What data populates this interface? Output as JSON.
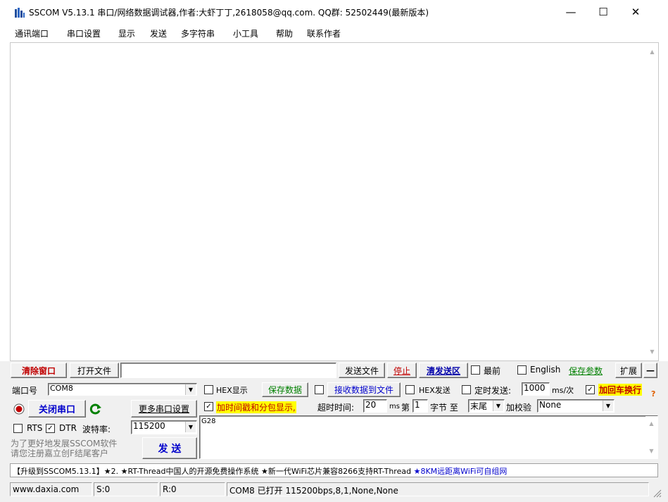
{
  "title": "SSCOM V5.13.1 串口/网络数据调试器,作者:大虾丁丁,2618058@qq.com. QQ群: 52502449(最新版本)",
  "window_controls": {
    "minimize": "—",
    "maximize": "☐",
    "close": "✕"
  },
  "menu": [
    "通讯端口",
    "串口设置",
    "显示",
    "发送",
    "多字符串",
    "小工具",
    "帮助",
    "联系作者"
  ],
  "toolbar": {
    "clear_window": "清除窗口",
    "open_file": "打开文件",
    "file_path": "",
    "send_file": "发送文件",
    "stop": "停止",
    "clear_send": "清发送区",
    "topmost": "最前",
    "english": "English",
    "save_params": "保存参数",
    "expand": "扩展",
    "collapse": "—"
  },
  "port": {
    "label": "端口号",
    "value": "COM8",
    "close_port": "关闭串口",
    "more_settings": "更多串口设置",
    "rts": "RTS",
    "rts_checked": false,
    "dtr": "DTR",
    "dtr_checked": true,
    "baud_label": "波特率:",
    "baud_value": "115200",
    "promo1": "为了更好地发展SSCOM软件",
    "promo2": "请您注册嘉立创F结尾客户",
    "send": "发 送"
  },
  "options": {
    "hex_display": "HEX显示",
    "hex_display_checked": false,
    "save_data": "保存数据",
    "recv_to_file": "接收数据到文件",
    "recv_to_file_checked": false,
    "hex_send": "HEX发送",
    "hex_send_checked": false,
    "timed_send": "定时发送:",
    "timed_send_checked": false,
    "interval": "1000",
    "interval_unit": "ms/次",
    "add_newline": "加回车换行",
    "add_newline_checked": true,
    "timestamp": "加时间戳和分包显示,",
    "timestamp_checked": true,
    "timeout_label": "超时时间:",
    "timeout_value": "20",
    "timeout_unit": "ms",
    "nth_label": "第",
    "nth_value": "1",
    "byte_to": "字节 至",
    "end_select": "末尾",
    "checksum_label": "加校验",
    "checksum_value": "None",
    "question": "?"
  },
  "send_text": "G28",
  "ticker": {
    "part1": "【升级到SSCOM5.13.1】★2. ★RT-Thread中国人的开源免费操作系统 ★新一代WiFi芯片兼容8266支持RT-Thread",
    "part2": "★8KM远距离WiFi可自组网"
  },
  "status": {
    "site": "www.daxia.com",
    "sent": "S:0",
    "recv": "R:0",
    "port_status": "COM8 已打开  115200bps,8,1,None,None"
  },
  "colors": {
    "red": "#c00000",
    "green": "#008000",
    "blue": "#0000cc",
    "highlight": "#ffff00"
  }
}
